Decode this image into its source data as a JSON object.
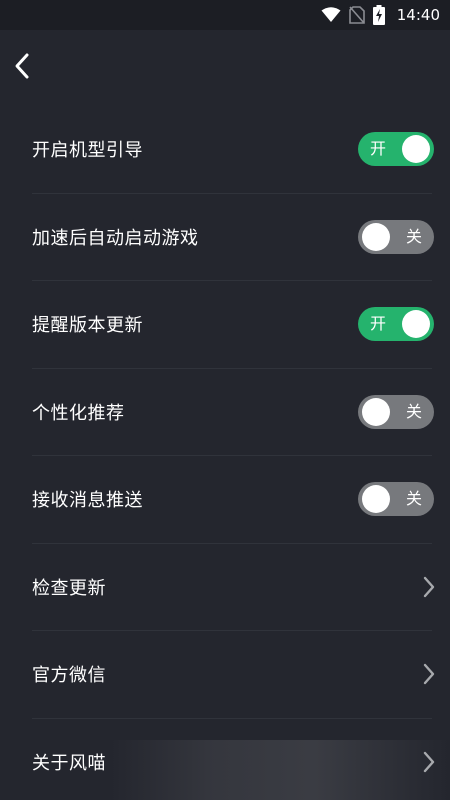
{
  "status_bar": {
    "time": "14:40",
    "icons": [
      "wifi-icon",
      "no-sim-icon",
      "battery-charging-icon"
    ]
  },
  "header": {
    "back_icon": "chevron-left-icon"
  },
  "settings": {
    "items": [
      {
        "label": "开启机型引导",
        "type": "toggle",
        "state": "on",
        "toggle_text": "开"
      },
      {
        "label": "加速后自动启动游戏",
        "type": "toggle",
        "state": "off",
        "toggle_text": "关"
      },
      {
        "label": "提醒版本更新",
        "type": "toggle",
        "state": "on",
        "toggle_text": "开"
      },
      {
        "label": "个性化推荐",
        "type": "toggle",
        "state": "off",
        "toggle_text": "关"
      },
      {
        "label": "接收消息推送",
        "type": "toggle",
        "state": "off",
        "toggle_text": "关"
      },
      {
        "label": "检查更新",
        "type": "link",
        "icon": "chevron-right-icon"
      },
      {
        "label": "官方微信",
        "type": "link",
        "icon": "chevron-right-icon"
      },
      {
        "label": "关于风喵",
        "type": "link",
        "icon": "chevron-right-icon"
      }
    ]
  },
  "colors": {
    "background": "#24262e",
    "toggle_on": "#25b36d",
    "toggle_off": "#77797d",
    "divider": "#30333b"
  }
}
